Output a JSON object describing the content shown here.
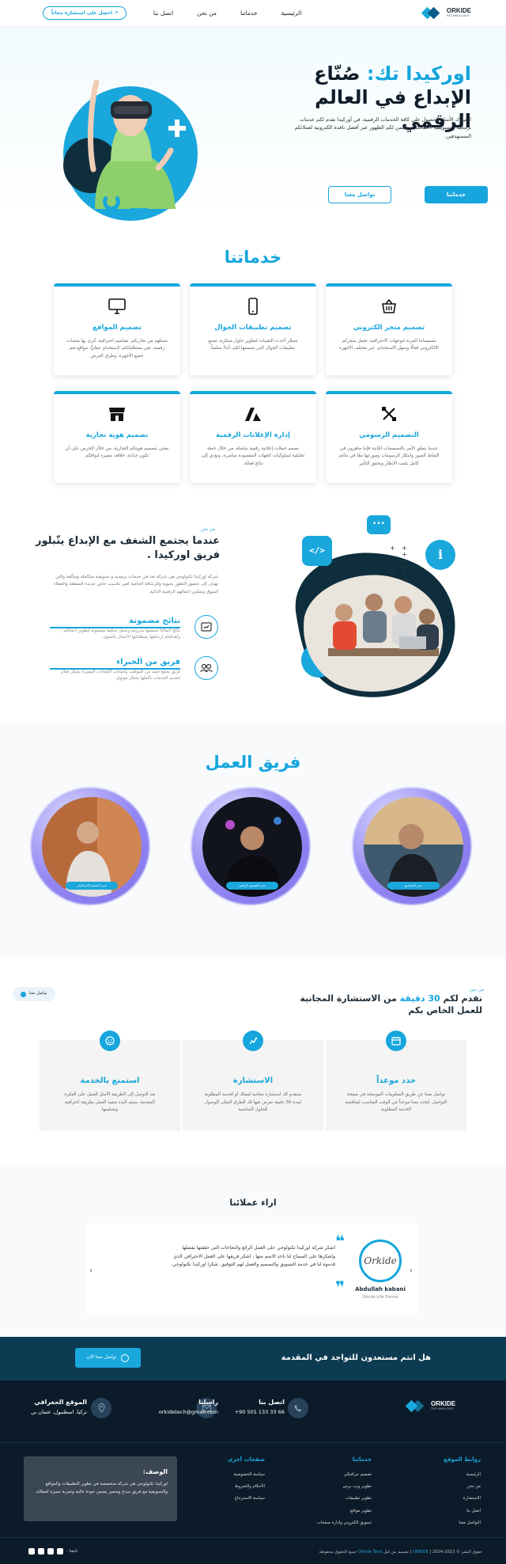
{
  "header": {
    "brand": "ORKIDE",
    "brand_sub": "TECHNOLOGY",
    "nav": [
      "الرئيسية",
      "خدماتنا",
      "من نحن",
      "اتصل بنا"
    ],
    "cta": "↗ احصل على استشارة مجاناً"
  },
  "hero": {
    "title_blue": "اوركيدا تك:",
    "title_rest": "صُنّاع الإبداع في العالم الرقمي",
    "description": "اختيارك الأمثل للحصول على كافة الخدمات الرقمية، في أوركيدا نقدم لكم خدمات برمجية و تسويقية لأعمالكم و نضمن لكم الظهور عبر أفضل نافذة الكترونية لعملائكم المستهدفين.",
    "btn_primary": "خدماتنا",
    "btn_secondary": "تواصل معنا"
  },
  "services": {
    "title": "خدماتنا",
    "cards": [
      {
        "icon": "basket-icon",
        "title": "تصميم متجر الكتروني",
        "text": "تصميماتنا المرنة لتوجهات الاحترافية، تجعل متجركم الالكتروني فعالًا وسهل الاستخدام، عبر مختلف الأجهزة"
      },
      {
        "icon": "mobile-icon",
        "title": "تصميم تطبيقات الجوال",
        "text": "نسخّر أحدث التقنيات لتطوير حلول مبتكرة، تصنع تطبيقات الجوال التي تصممها لكم، أداءً سلساً"
      },
      {
        "icon": "monitor-icon",
        "title": "تصميم المواقع",
        "text": "نستلهم من تجاربكم، تصاميم احترافية، تُثرى بها منصات رقمية، نقي بمتطلباتكم، لاستخدام عمليٌّ، مواقع تعم جميع الأجهزة، وطرق العرض"
      },
      {
        "icon": "design-tools-icon",
        "title": "التصميم الرسومي",
        "text": "عندما يتعلق الأمر بالتصميمات الثابتة فإننا ماهرون في التقاط الصور وابتكار الرسومات وموزعها معًا في تناغم كامل يلفت الأنظار ويحقق التأثير"
      },
      {
        "icon": "ads-icon",
        "title": "إدارة الإعلانات الرقمية",
        "text": "نصمم حملات إعلانية رقمية شاملة، من خلال خطة تحليلية لسلوكيات الجهات المقصودة مباشرة، وتؤدي إلى نتائج فعالة."
      },
      {
        "icon": "store-icon",
        "title": "تصميم هوية تجارية",
        "text": "نعتني بتصميم هويتكم التجارية، من خلال الحرص على أن تكون جذابة، خلاقة، مميزة لنوافكم"
      }
    ]
  },
  "about": {
    "eyebrow": "من نحن",
    "title": "عندما يجتمع الشغف مع الإبداع يتّبلور فريق اوركيدا .",
    "description": "شركة اوركيدا تكنولوجي هي شركة تعد في خدمات برمجية و تسويقية متكاملة ومتألقة والتي تهدف إلى تحقيق التطور بحيوية والرشاقة الخاصة لغير تتاسبت خاص جديدة المنطقة والعملاء السوق وتمكين اعمالهم الرقمية الذكية.",
    "features": [
      {
        "icon": "results-icon",
        "title": "نتائج مضمونة",
        "text": "نتائج أعمالنا تحمسها بحروتية وتحمل بحكمة مضمونة لتطوير أعمالكم وأهدافكم ارتباطها بمتطلباتها الأعمال بالسوق."
      },
      {
        "icon": "team-icon",
        "title": "فريق من الخبراء",
        "text": "فريق يجمع حشد من المواهب وأصحاب الكفاءات المميزة بشكل فعال لتقديم الخدمات بأكملها بشكل موثوق."
      }
    ]
  },
  "team": {
    "title": "فريق العمل",
    "members": [
      {
        "tag": "مدير المشاريع"
      },
      {
        "tag": "مدير التسويق الرقمي"
      },
      {
        "tag": "مدير التصميم الجرافيكي"
      }
    ]
  },
  "consult": {
    "eyebrow": "من نحن",
    "title_pre": "نقدم لكم",
    "title_blue": "30 دقيقة",
    "title_post": "من الاستشارة المجانية للعمل الخاص بكم",
    "contact_btn": "تواصل معنا",
    "steps": [
      {
        "icon": "calendar-icon",
        "title": "حدد موعداً",
        "text": "تواصل معنا عن طريق المعلومات الموضحة في صفحة التواصل، لتحدد معنا موعداً في الوقت المناسب لمناقشة الخدمة المطلوبة"
      },
      {
        "icon": "consult-icon",
        "title": "الاستشارة",
        "text": "سنقدم لك استشارة مجانية لعملك أو لخدمة المطلوبة لمدة 30 دقيقة نعرض فيها لك الطرق المثلى للوصول للحلول المناسبة"
      },
      {
        "icon": "smile-icon",
        "title": "استمتع بالخدمة",
        "text": "بعد التوصل إلى الطريقة الأمثل للعمل على الفكرة المقدمة، سيتم البدء بتنفيذ العمل بطريقة احترافية وتسليمها"
      }
    ]
  },
  "testimonials": {
    "title": "اراء عملائنا",
    "quote": "اشكر شركة اوركيدا تكنولوجي على العمل الرائع والنجاحات التي حققتها بفضلها واشكرها على السماح لنا باخذ الاسم منها ، اشكر فريقها على العمل الاحترافي الذي قدموه لنا في خدمة التسويق والتصميم والعمل لهم التوفيق. شكرا اوركيدا تكنولوجي.",
    "author": "Abdullah kabani",
    "company": "Orkide Life Damar",
    "avatar_text": "Orkide"
  },
  "cta_bar": {
    "text": "هل انتم مستعدون للتواجد في المقدمة",
    "button": "تواصل معنا الان"
  },
  "footer": {
    "location_label": "الموقع الجغرافي",
    "location_value": "تركيا، اسطنبول، عثمان بي",
    "mail_label": "راسلنا",
    "mail_value": "orkidetech@gmail.com",
    "phone_label": "اتصل بنا",
    "phone_value": "+90 501 133 33 66",
    "cols": [
      {
        "title": "روابط الموقع",
        "links": [
          "الرئيسية",
          "من نحن",
          "الاستشارة",
          "اتصل بنا",
          "التواصل معنا"
        ]
      },
      {
        "title": "خدماتنا",
        "links": [
          "تصميم جرافيكي",
          "تطوير ويب برس",
          "تطوير تطبيقات",
          "تطوير مواقع",
          "تسويق الكتروني وادارة صفحات"
        ]
      },
      {
        "title": "صفحات أخرى",
        "links": [
          "سياسة الخصوصية",
          "الأحكام والشروط",
          "سياسة الاسترجاع"
        ]
      }
    ],
    "desc_title": "الوصف:",
    "desc_text": "اوركيدا تكنولوجي هي شركة متخصصة في تطوير التطبيقات والمواقع والتسويقية مع فريق مبدع ومتميز يضمن جودة عالية وتجربة مميزة لعملائه.",
    "copyright_a": "حقوق النشر © 2023-2024 | ",
    "copyright_blue": "ORKIDE",
    "copyright_b": " | تصميم من قبل ",
    "copyright_blue2": "Orkide Tech",
    "copyright_c": " جميع الحقوق محفوظة",
    "social_label": "تابعنا :"
  },
  "colors": {
    "accent": "#16a6dd",
    "dark": "#0c1b29",
    "cta": "#0d3b52"
  }
}
